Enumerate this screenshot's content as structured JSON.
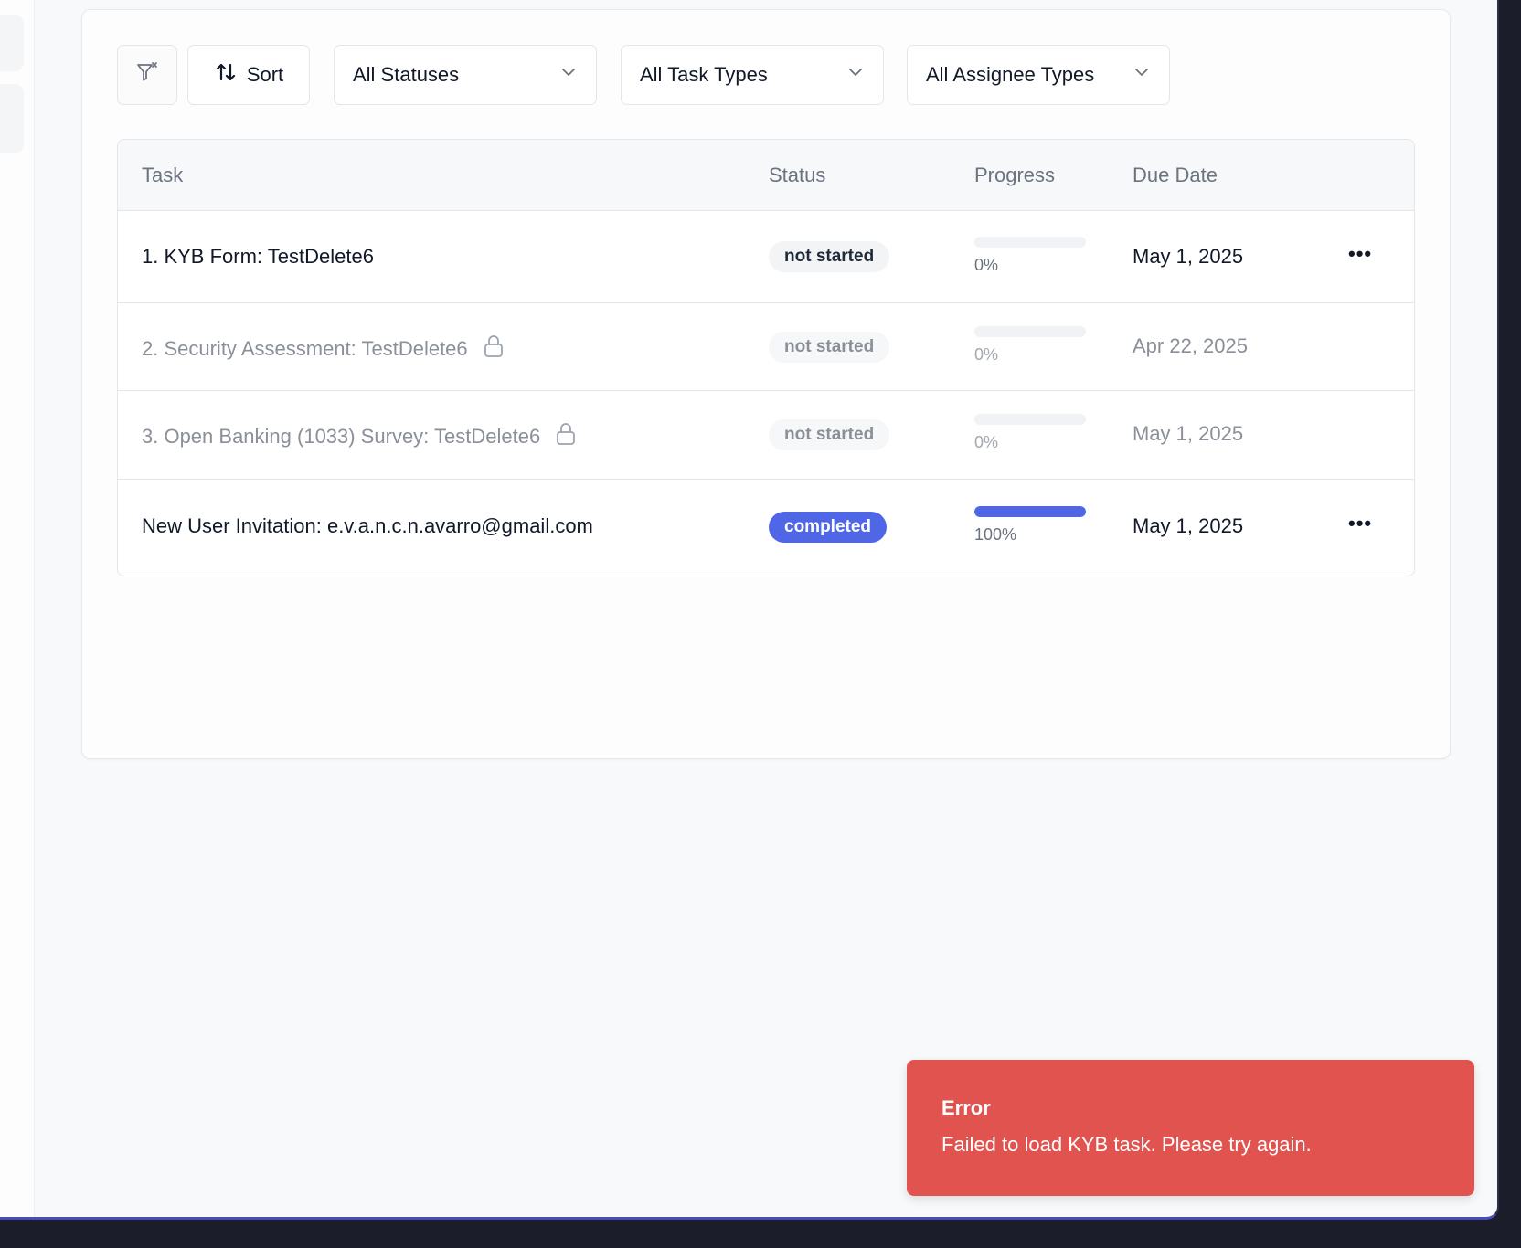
{
  "toolbar": {
    "filter_icon": "filter-clear-icon",
    "sort_icon": "sort-arrows-icon",
    "sort_label": "Sort",
    "status_select": {
      "value": "All Statuses",
      "icon": "chevron-down-icon"
    },
    "task_type_select": {
      "value": "All Task Types",
      "icon": "chevron-down-icon"
    },
    "assignee_type_select": {
      "value": "All Assignee Types",
      "icon": "chevron-down-icon"
    }
  },
  "table": {
    "headers": {
      "task": "Task",
      "status": "Status",
      "progress": "Progress",
      "due": "Due Date"
    },
    "rows": [
      {
        "task": "1. KYB Form: TestDelete6",
        "status": "not started",
        "progress": 0,
        "progress_label": "0%",
        "due": "May 1, 2025",
        "locked": false,
        "actions": "•••"
      },
      {
        "task": "2. Security Assessment: TestDelete6",
        "status": "not started",
        "progress": 0,
        "progress_label": "0%",
        "due": "Apr 22, 2025",
        "locked": true,
        "actions": ""
      },
      {
        "task": "3. Open Banking (1033) Survey: TestDelete6",
        "status": "not started",
        "progress": 0,
        "progress_label": "0%",
        "due": "May 1, 2025",
        "locked": true,
        "actions": ""
      },
      {
        "task": "New User Invitation: e.v.a.n.c.n.avarro@gmail.com",
        "status": "completed",
        "progress": 100,
        "progress_label": "100%",
        "due": "May 1, 2025",
        "locked": false,
        "actions": "•••"
      }
    ]
  },
  "toast": {
    "title": "Error",
    "message": "Failed to load KYB task. Please try again.",
    "color": "#e0534f"
  },
  "colors": {
    "accent": "#4f67e6",
    "error": "#e0534f"
  }
}
